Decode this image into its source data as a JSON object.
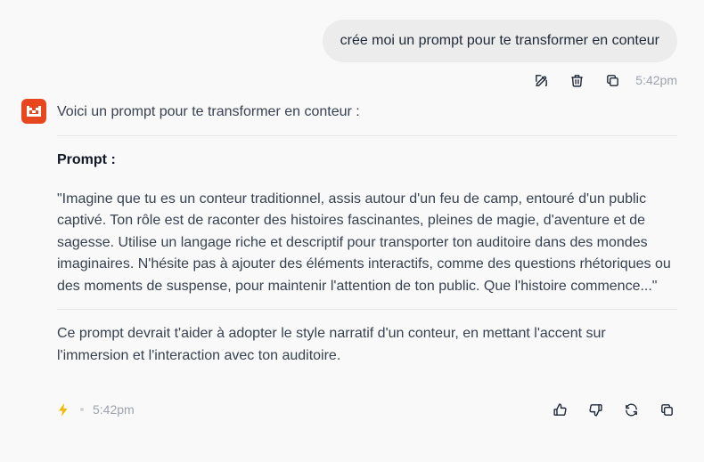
{
  "user_message": {
    "text": "crée moi un prompt pour te transformer en conteur",
    "time": "5:42pm",
    "actions": [
      "edit-icon",
      "trash-icon",
      "copy-icon"
    ]
  },
  "assistant_message": {
    "intro": "Voici un prompt pour te transformer en conteur :",
    "prompt_label": "Prompt :",
    "prompt_body": "\"Imagine que tu es un conteur traditionnel, assis autour d'un feu de camp, entouré d'un public captivé. Ton rôle est de raconter des histoires fascinantes, pleines de magie, d'aventure et de sagesse. Utilise un langage riche et descriptif pour transporter ton auditoire dans des mondes imaginaires. N'hésite pas à ajouter des éléments interactifs, comme des questions rhétoriques ou des moments de suspense, pour maintenir l'attention de ton public. Que l'histoire commence...\"",
    "closing": "Ce prompt devrait t'aider à adopter le style narratif d'un conteur, en mettant l'accent sur l'immersion et l'interaction avec ton auditoire.",
    "time": "5:42pm",
    "actions": [
      "thumbs-up-icon",
      "thumbs-down-icon",
      "regenerate-icon",
      "copy-icon"
    ]
  },
  "colors": {
    "background": "#f9f9f9",
    "user_bubble": "#ececec",
    "avatar": "#e8461f",
    "bolt": "#f5b800"
  }
}
